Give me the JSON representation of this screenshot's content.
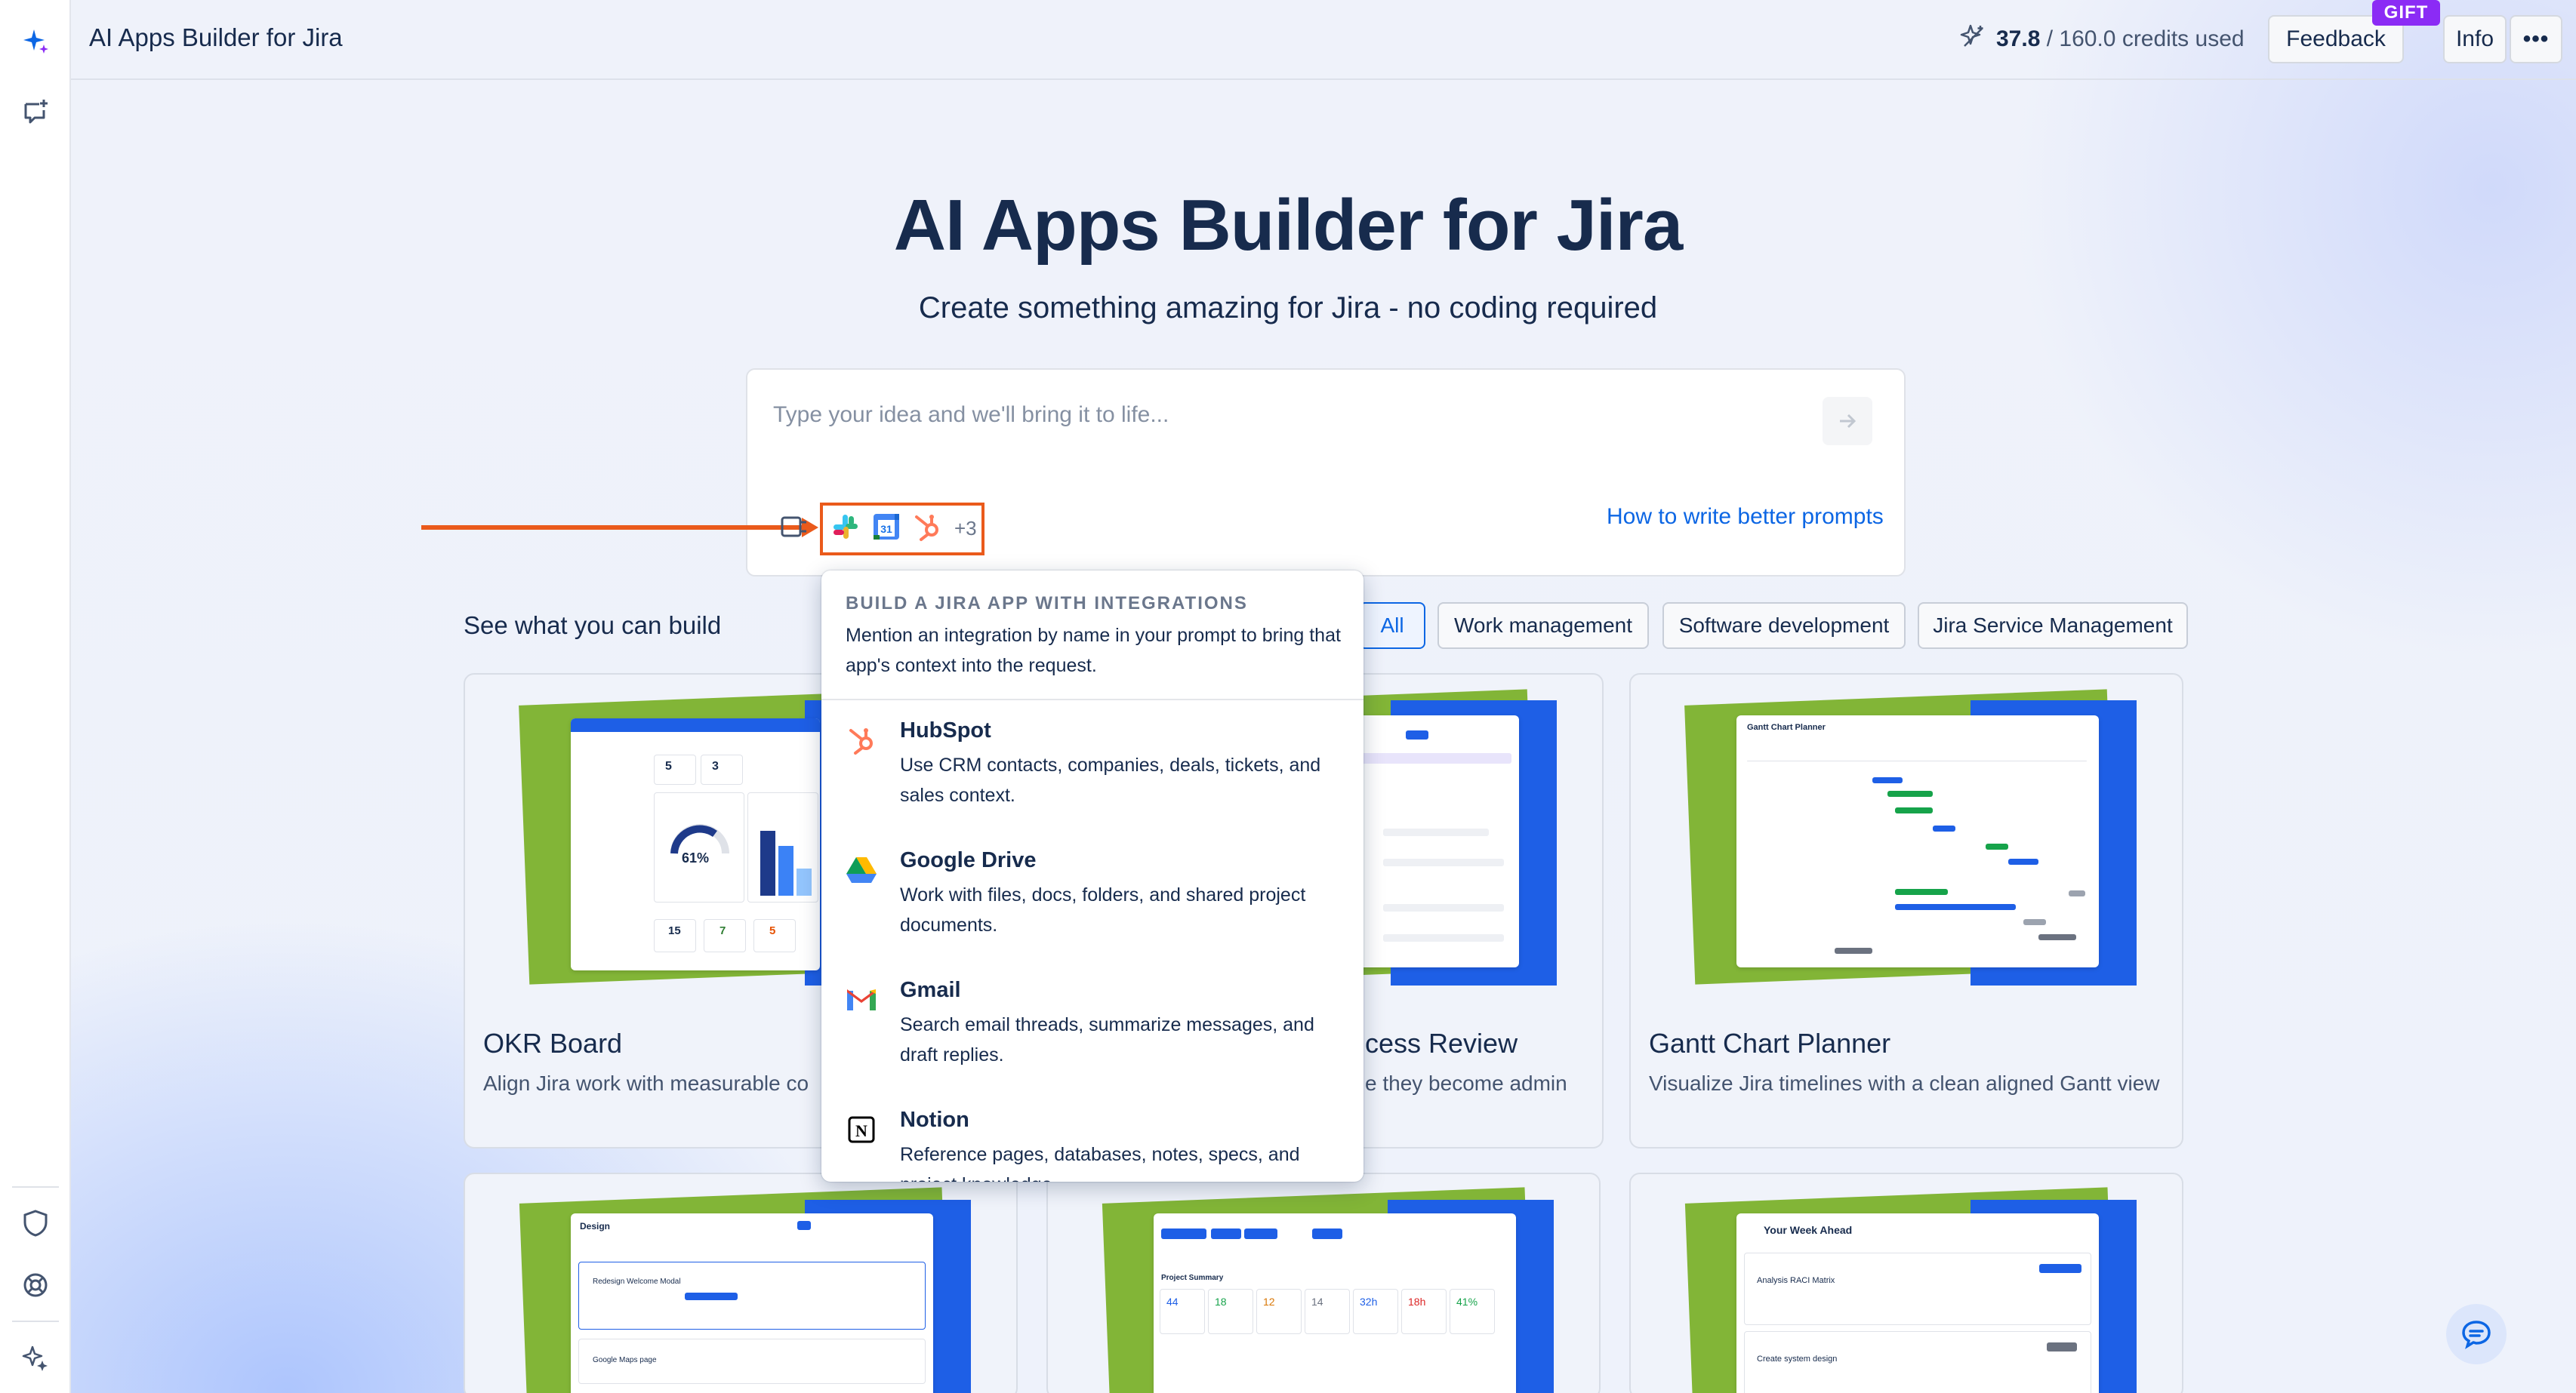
{
  "app": {
    "title": "AI Apps Builder for Jira"
  },
  "topbar": {
    "credits_used": "37.8",
    "credits_rest": "/ 160.0 credits used",
    "feedback_label": "Feedback",
    "gift_badge": "GIFT",
    "info_label": "Info",
    "more_label": "•••"
  },
  "hero": {
    "title": "AI Apps Builder for Jira",
    "subtitle": "Create something amazing for Jira - no coding required"
  },
  "prompt": {
    "placeholder": "Type your idea and we'll bring it to life...",
    "value": "",
    "howto_link": "How to write better prompts",
    "integrations_more": "+3"
  },
  "gallery": {
    "section_title": "See what you can build",
    "filters": [
      {
        "label": "All",
        "active": true
      },
      {
        "label": "Work management",
        "active": false
      },
      {
        "label": "Software development",
        "active": false
      },
      {
        "label": "Jira Service Management",
        "active": false
      }
    ],
    "cards": [
      {
        "title": "OKR Board",
        "description": "Align Jira work with measurable co"
      },
      {
        "title": "cess Review",
        "description": "e they become admin"
      },
      {
        "title": "Gantt Chart Planner",
        "description": "Visualize Jira timelines with a clean aligned Gantt view"
      }
    ],
    "okr_preview": {
      "percent": "61%",
      "stats": [
        "15",
        "7",
        "5"
      ],
      "top_stats": [
        "5",
        "3"
      ]
    },
    "gantt_preview": {
      "title": "Gantt Chart Planner"
    },
    "design_preview": {
      "title": "Design",
      "row1": "Redesign Welcome Modal",
      "row2": "Google Maps page"
    },
    "summary_preview": {
      "title": "Project Summary",
      "values": [
        "44",
        "18",
        "12",
        "14",
        "32h",
        "18h",
        "41%"
      ]
    },
    "week_preview": {
      "title": "Your Week Ahead",
      "row1": "Analysis RACI Matrix",
      "row2": "Create system design"
    }
  },
  "dropdown": {
    "heading": "BUILD A JIRA APP WITH INTEGRATIONS",
    "help": "Mention an integration by name in your prompt to bring that app's context into the request.",
    "items": [
      {
        "name": "HubSpot",
        "description": "Use CRM contacts, companies, deals, tickets, and sales context.",
        "icon": "hubspot-icon"
      },
      {
        "name": "Google Drive",
        "description": "Work with files, docs, folders, and shared project documents.",
        "icon": "google-drive-icon"
      },
      {
        "name": "Gmail",
        "description": "Search email threads, summarize messages, and draft replies.",
        "icon": "gmail-icon"
      },
      {
        "name": "Notion",
        "description": "Reference pages, databases, notes, specs, and project knowledge.",
        "icon": "notion-icon"
      }
    ]
  },
  "colors": {
    "accent": "#0c66e4",
    "highlight": "#ea5a1b",
    "gift": "#8b2bf5",
    "card_green": "#82b537",
    "card_blue": "#1e5fe6"
  }
}
